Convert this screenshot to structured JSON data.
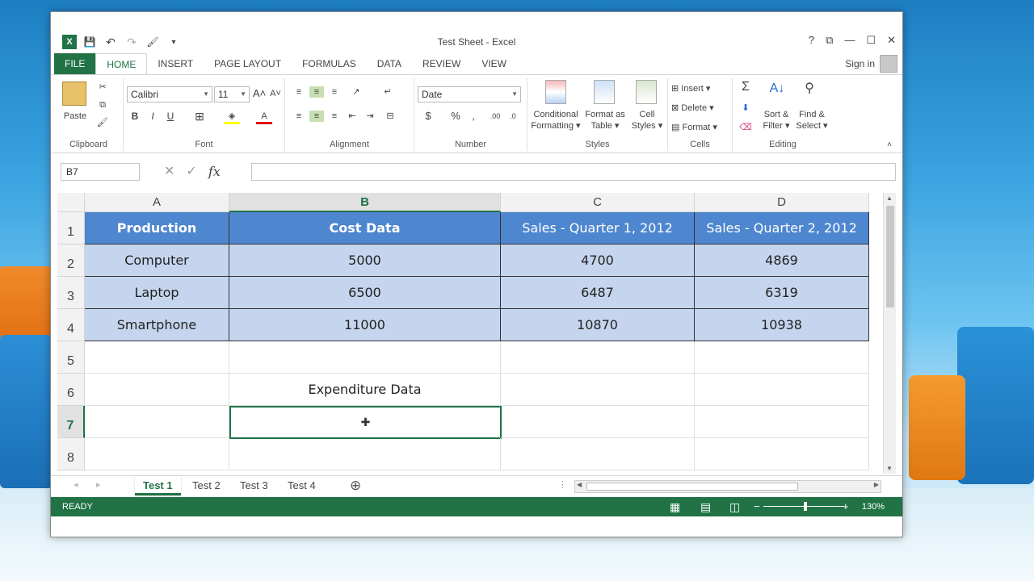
{
  "window": {
    "title": "Test Sheet - Excel"
  },
  "qat": {
    "excel": "X",
    "save": "💾",
    "undo": "↶",
    "redo": "↷",
    "paint": "🖌",
    "more": "▾"
  },
  "ribbon_tabs": [
    "FILE",
    "HOME",
    "INSERT",
    "PAGE LAYOUT",
    "FORMULAS",
    "DATA",
    "REVIEW",
    "VIEW"
  ],
  "sign_in": "Sign in",
  "clipboard": {
    "paste": "Paste",
    "label": "Clipboard"
  },
  "font": {
    "name": "Calibri",
    "size": "11",
    "bold": "B",
    "italic": "I",
    "underline": "U",
    "label": "Font"
  },
  "alignment": {
    "label": "Alignment"
  },
  "number": {
    "format": "Date",
    "currency": "$",
    "percent": "%",
    "comma": ",",
    "inc": ".00",
    "dec": ".0",
    "label": "Number"
  },
  "styles": {
    "conditional1": "Conditional",
    "conditional2": "Formatting",
    "format_table1": "Format as",
    "format_table2": "Table",
    "cell_styles1": "Cell",
    "cell_styles2": "Styles",
    "label": "Styles"
  },
  "cells": {
    "insert": "Insert",
    "delete": "Delete",
    "format": "Format",
    "label": "Cells"
  },
  "editing": {
    "sum": "Σ",
    "sort1": "Sort &",
    "sort2": "Filter",
    "find1": "Find &",
    "find2": "Select",
    "label": "Editing"
  },
  "formula_bar": {
    "name_box": "B7",
    "cancel": "✕",
    "enter": "✓",
    "fx": "fx",
    "value": ""
  },
  "columns": [
    "A",
    "B",
    "C",
    "D"
  ],
  "rows": [
    "1",
    "2",
    "3",
    "4",
    "5",
    "6",
    "7",
    "8"
  ],
  "table": {
    "headers": [
      "Production",
      "Cost Data",
      "Sales - Quarter 1, 2012",
      "Sales - Quarter 2, 2012"
    ],
    "data": [
      [
        "Computer",
        "5000",
        "4700",
        "4869"
      ],
      [
        "Laptop",
        "6500",
        "6487",
        "6319"
      ],
      [
        "Smartphone",
        "11000",
        "10870",
        "10938"
      ]
    ]
  },
  "b6": "Expenditure Data",
  "sheets": [
    "Test 1",
    "Test 2",
    "Test 3",
    "Test 4"
  ],
  "add_sheet": "⊕",
  "status": {
    "ready": "READY",
    "zoom": "130%"
  },
  "colors": {
    "excel_green": "#217346",
    "header_blue": "#4e86cf",
    "data_blue": "#c5d5ee"
  }
}
